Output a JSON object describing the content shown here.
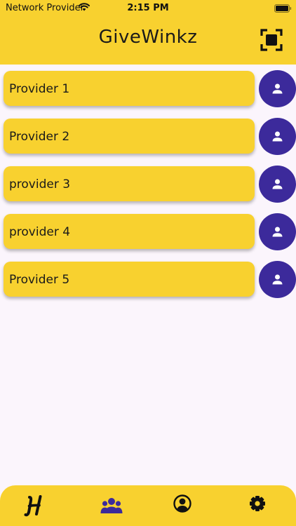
{
  "status_bar": {
    "carrier": "Network Provider",
    "time": "2:15 PM"
  },
  "header": {
    "title": "GiveWinkz",
    "scan_icon": "scan-frame-icon"
  },
  "providers": [
    {
      "label": "Provider 1"
    },
    {
      "label": "Provider 2"
    },
    {
      "label": "provider 3"
    },
    {
      "label": "provider 4"
    },
    {
      "label": "Provider 5"
    }
  ],
  "tabbar": {
    "tabs": [
      {
        "icon": "home-h-logo-icon",
        "active": false
      },
      {
        "icon": "group-icon",
        "active": true
      },
      {
        "icon": "account-circle-icon",
        "active": false
      },
      {
        "icon": "settings-gear-icon",
        "active": false
      }
    ]
  },
  "colors": {
    "accent": "#F8D12F",
    "avatar": "#3C2A9B",
    "background": "#FBF5FC",
    "active_tab": "#3C2A9B"
  }
}
